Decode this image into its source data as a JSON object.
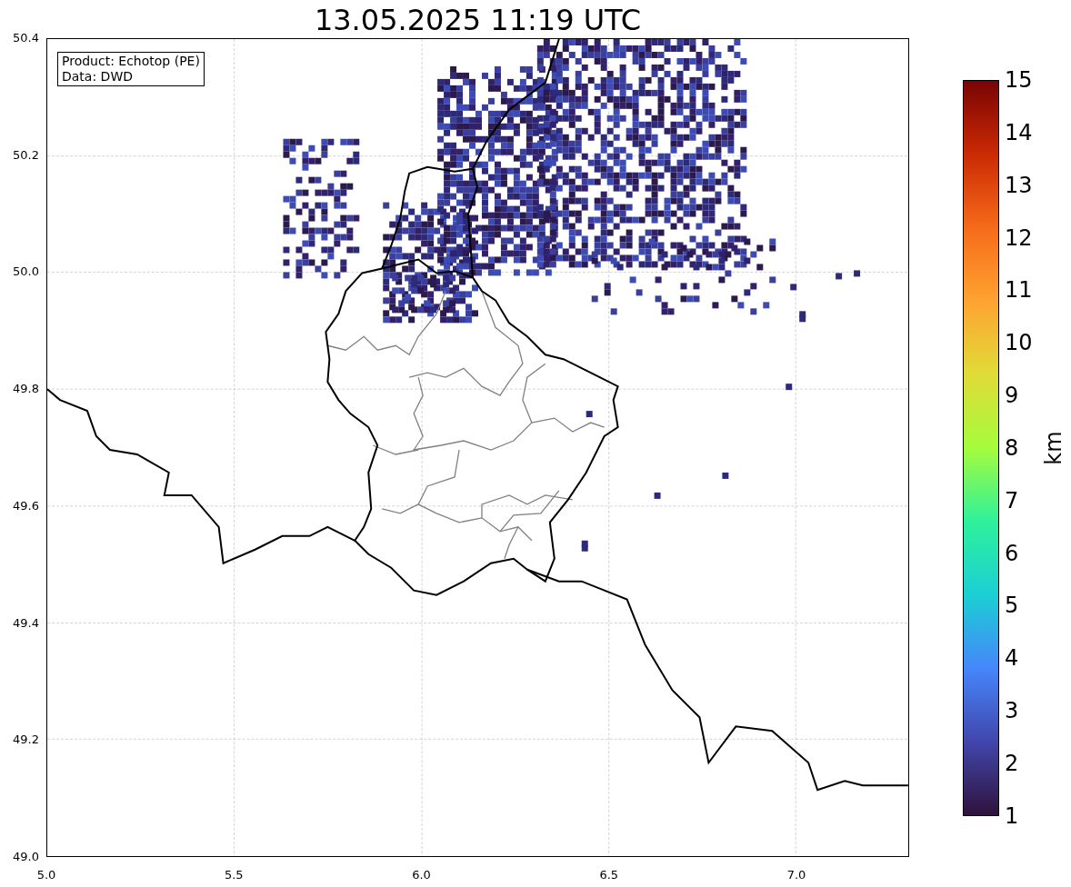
{
  "title": "13.05.2025 11:19 UTC",
  "legend": [
    "Product: Echotop (PE)",
    "Data: DWD"
  ],
  "yticks": [
    "50.4",
    "50.2",
    "50.0",
    "49.8",
    "49.6",
    "49.4",
    "49.2",
    "49.0"
  ],
  "xticks": [
    "5.0",
    "5.5",
    "6.0",
    "6.5",
    "7.0"
  ],
  "colorbar": {
    "label": "km",
    "ticks": [
      "15",
      "14",
      "13",
      "12",
      "11",
      "10",
      "9",
      "8",
      "7",
      "6",
      "5",
      "4",
      "3",
      "2",
      "1"
    ]
  }
}
